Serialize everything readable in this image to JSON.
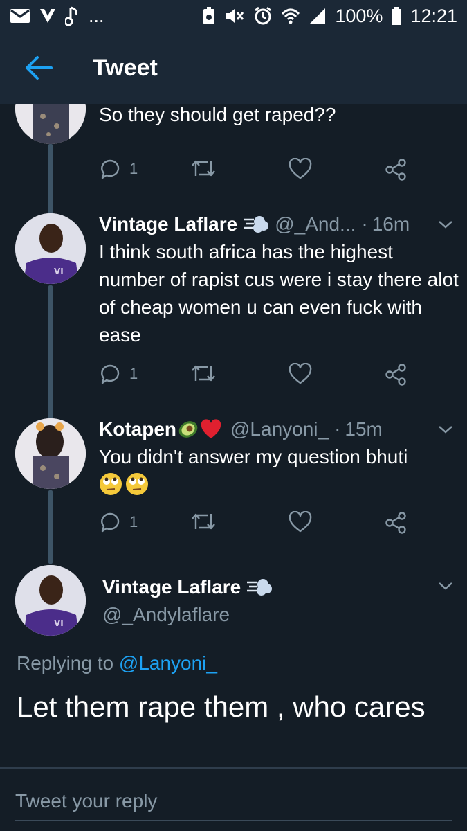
{
  "status_bar": {
    "ellipsis": "...",
    "battery": "100%",
    "time": "12:21"
  },
  "header": {
    "title": "Tweet"
  },
  "tweets": [
    {
      "text": "So they should get raped??",
      "reply_count": "1"
    },
    {
      "name": "Vintage Laflare",
      "handle": "@_And...",
      "dot": "·",
      "time": "16m",
      "text": "I think south africa has the highest number of rapist cus were i stay there alot of cheap women u can even fuck with ease",
      "reply_count": "1"
    },
    {
      "name": "Kotapen",
      "handle": "@Lanyoni_",
      "dot": "·",
      "time": "15m",
      "text": "You didn't answer my question bhuti",
      "reply_count": "1"
    }
  ],
  "main_tweet": {
    "name": "Vintage Laflare",
    "handle": "@_Andylaflare",
    "replying_prefix": "Replying to",
    "replying_to": "@Lanyoni_",
    "text": "Let them rape them , who cares"
  },
  "reply_bar": {
    "placeholder": "Tweet your reply"
  },
  "colors": {
    "background": "#141d26",
    "header": "#1b2836",
    "accent": "#1da1f2",
    "secondary_text": "#8899a6",
    "thread_line": "#3d5466"
  }
}
